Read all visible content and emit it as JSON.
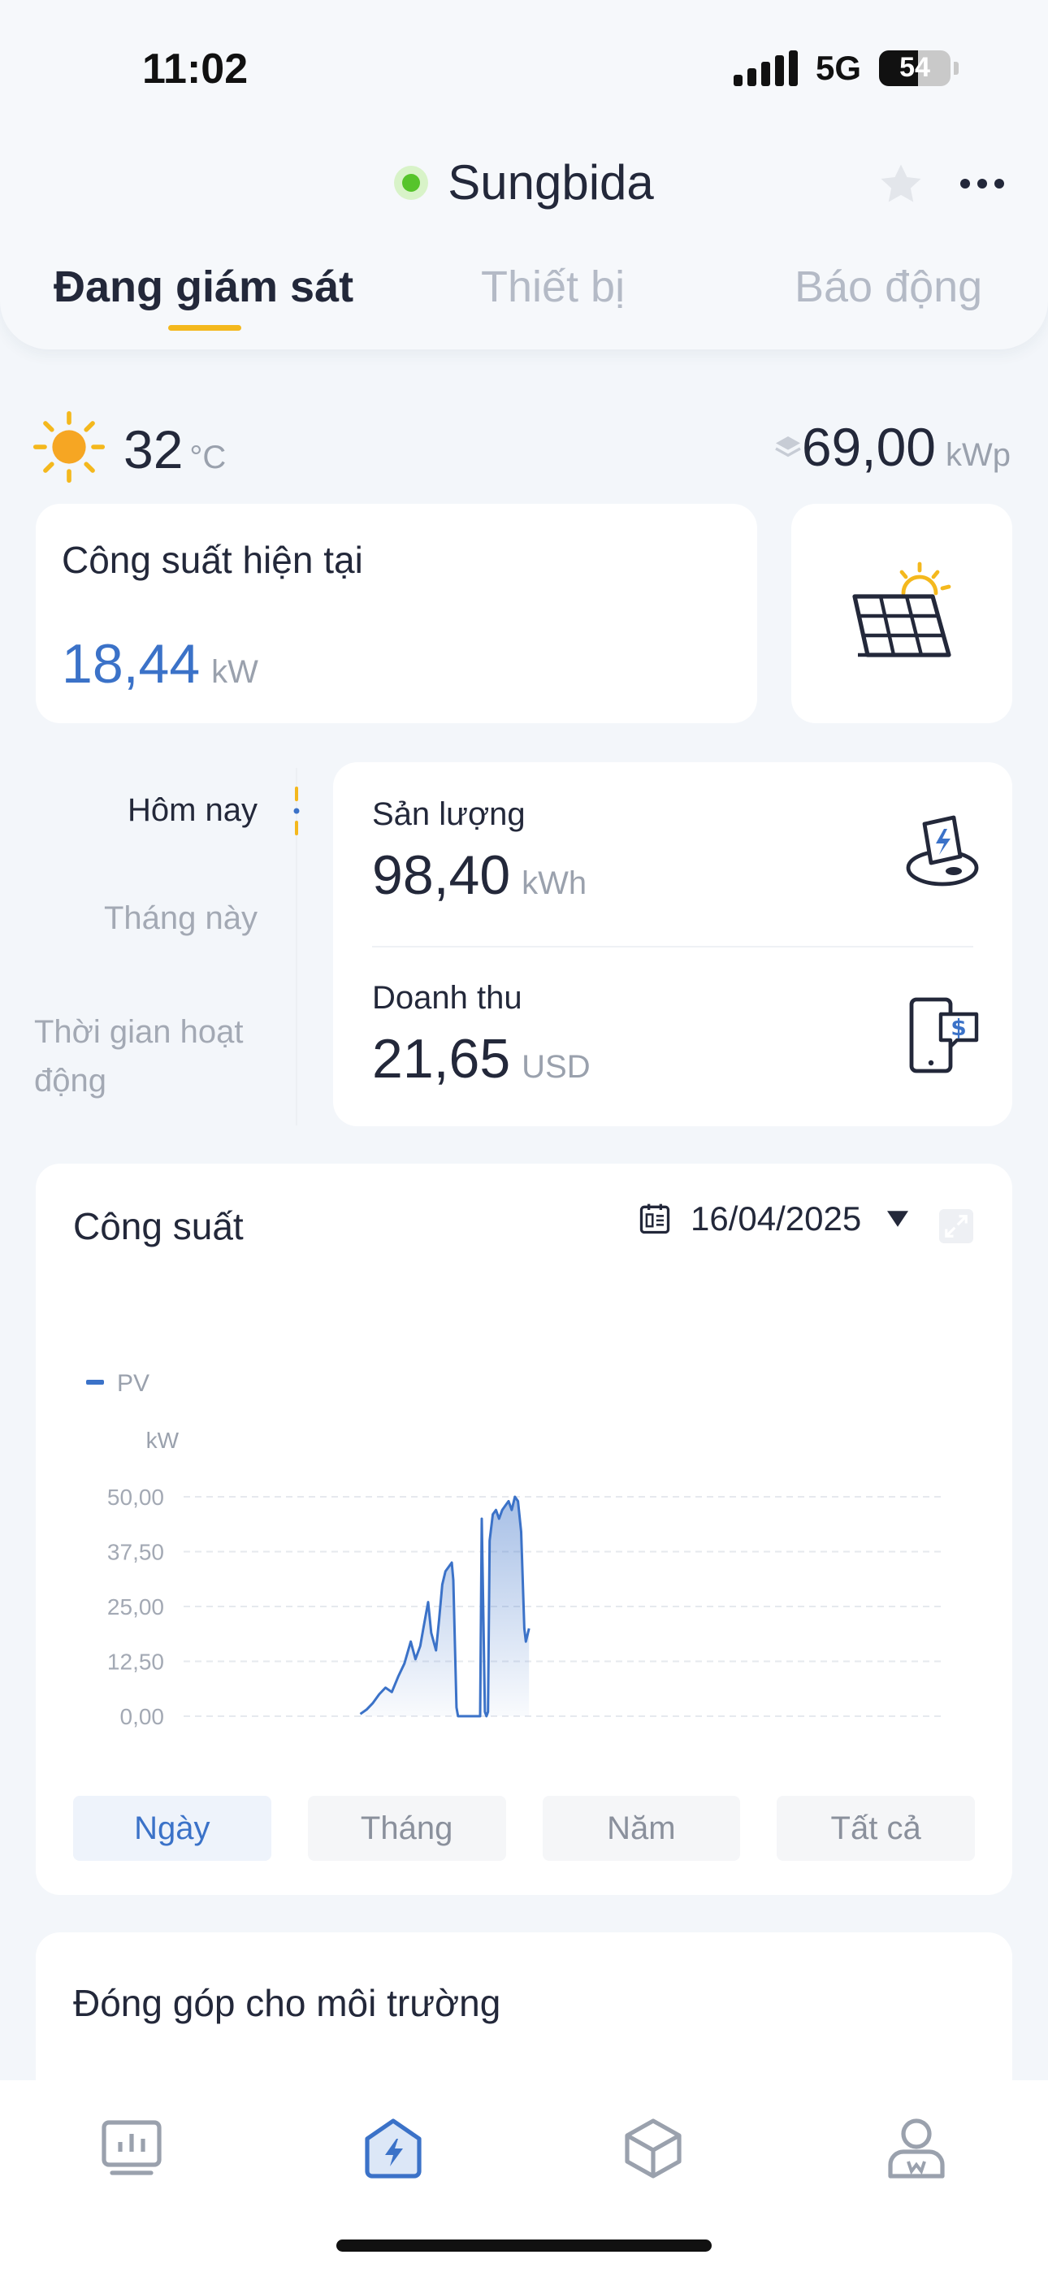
{
  "status_bar": {
    "time": "11:02",
    "network": "5G",
    "battery": "54"
  },
  "header": {
    "site_name": "Sungbida",
    "tabs": [
      {
        "label": "Đang giám sát",
        "active": true
      },
      {
        "label": "Thiết bị",
        "active": false
      },
      {
        "label": "Báo động",
        "active": false
      }
    ]
  },
  "weather": {
    "temperature": "32",
    "temperature_unit": "°C"
  },
  "capacity": {
    "value": "69,00",
    "unit": "kWp"
  },
  "current_power": {
    "label": "Công suất hiện tại",
    "value": "18,44",
    "unit": "kW"
  },
  "periods": [
    {
      "label": "Hôm nay",
      "active": true
    },
    {
      "label": "Tháng này",
      "active": false
    },
    {
      "label": "Thời gian hoạt",
      "label2": "động",
      "active": false
    }
  ],
  "stats": {
    "yield": {
      "label": "Sản lượng",
      "value": "98,40",
      "unit": "kWh"
    },
    "revenue": {
      "label": "Doanh thu",
      "value": "21,65",
      "unit": "USD"
    }
  },
  "chart_section": {
    "title": "Công suất",
    "date": "16/04/2025",
    "segments": [
      {
        "label": "Ngày",
        "active": true
      },
      {
        "label": "Tháng",
        "active": false
      },
      {
        "label": "Năm",
        "active": false
      },
      {
        "label": "Tất cả",
        "active": false
      }
    ]
  },
  "chart_data": {
    "type": "area",
    "ylabel": "kW",
    "ylim": [
      0,
      50
    ],
    "y_ticks": [
      "0,00",
      "12,50",
      "25,00",
      "37,50",
      "50,00"
    ],
    "xlim": [
      0,
      24
    ],
    "x_ticks": [
      0,
      2,
      4,
      6,
      8,
      10,
      12,
      14,
      16,
      18,
      20,
      22
    ],
    "legend_position": "top-left",
    "grid": true,
    "series": [
      {
        "name": "PV",
        "color": "#3b72c8",
        "x": [
          5.6,
          5.8,
          6.0,
          6.2,
          6.4,
          6.6,
          6.8,
          7.0,
          7.2,
          7.35,
          7.5,
          7.6,
          7.75,
          7.85,
          8.0,
          8.1,
          8.2,
          8.3,
          8.4,
          8.5,
          8.55,
          8.65,
          8.7,
          8.75,
          9.4,
          9.45,
          9.55,
          9.6,
          9.65,
          9.7,
          9.8,
          9.9,
          10.0,
          10.1,
          10.2,
          10.3,
          10.4,
          10.5,
          10.6,
          10.7,
          10.8,
          10.85,
          10.95
        ],
        "values": [
          0.5,
          1.5,
          3,
          5,
          6.5,
          5.5,
          9,
          12,
          17,
          13,
          16,
          20,
          26,
          19,
          15,
          22,
          30,
          33,
          34,
          35,
          31,
          2,
          0,
          0,
          0,
          45,
          1,
          0,
          1,
          40,
          46,
          47,
          45,
          47,
          48,
          49,
          47,
          50,
          49,
          42,
          20,
          17,
          20
        ]
      }
    ]
  },
  "environment": {
    "title": "Đóng góp cho môi trường"
  },
  "bottom_nav": [
    {
      "name": "overview-icon",
      "active": false
    },
    {
      "name": "plant-icon",
      "active": true
    },
    {
      "name": "device-icon",
      "active": false
    },
    {
      "name": "profile-icon",
      "active": false
    }
  ],
  "colors": {
    "accent": "#3b72c8",
    "tab_indicator": "#f4b81d",
    "online": "#56c42b"
  }
}
